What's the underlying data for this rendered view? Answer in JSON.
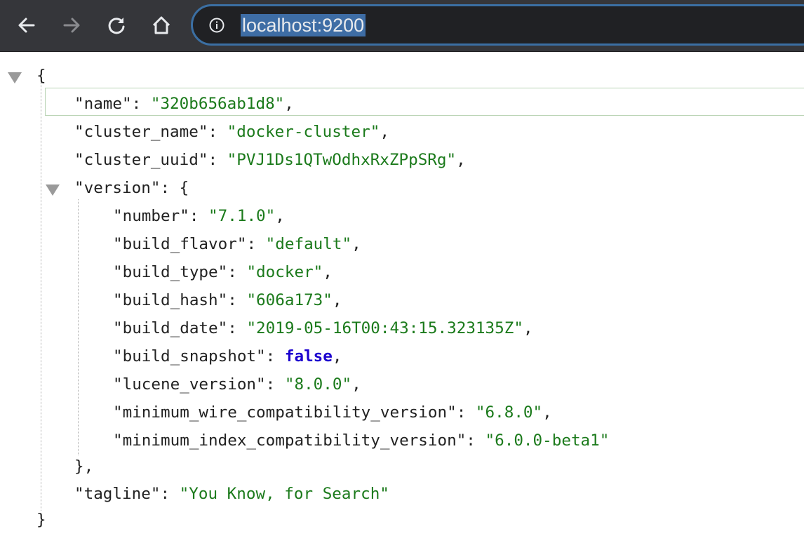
{
  "browser": {
    "back_icon": "arrow-left-icon",
    "forward_icon": "arrow-right-icon",
    "reload_icon": "reload-icon",
    "home_icon": "home-icon",
    "info_icon": "info-icon",
    "url": "localhost:9200",
    "colors": {
      "toolbar": "#35363a",
      "omnibox": "#202124",
      "focus_ring": "#3b6fa3",
      "selection": "#3e6da5"
    }
  },
  "json_viewer": {
    "open_brace": "{",
    "close_brace": "}",
    "fields": [
      {
        "key": "\"name\"",
        "value": "\"320b656ab1d8\"",
        "sep": ","
      },
      {
        "key": "\"cluster_name\"",
        "value": "\"docker-cluster\"",
        "sep": ","
      },
      {
        "key": "\"cluster_uuid\"",
        "value": "\"PVJ1Ds1QTwOdhxRxZPpSRg\"",
        "sep": ","
      }
    ],
    "version": {
      "key": "\"version\"",
      "open": "{",
      "close": "},",
      "fields": [
        {
          "key": "\"number\"",
          "value": "\"7.1.0\"",
          "sep": ","
        },
        {
          "key": "\"build_flavor\"",
          "value": "\"default\"",
          "sep": ","
        },
        {
          "key": "\"build_type\"",
          "value": "\"docker\"",
          "sep": ","
        },
        {
          "key": "\"build_hash\"",
          "value": "\"606a173\"",
          "sep": ","
        },
        {
          "key": "\"build_date\"",
          "value": "\"2019-05-16T00:43:15.323135Z\"",
          "sep": ","
        },
        {
          "key": "\"build_snapshot\"",
          "value": "false",
          "sep": ","
        },
        {
          "key": "\"lucene_version\"",
          "value": "\"8.0.0\"",
          "sep": ","
        },
        {
          "key": "\"minimum_wire_compatibility_version\"",
          "value": "\"6.8.0\"",
          "sep": ","
        },
        {
          "key": "\"minimum_index_compatibility_version\"",
          "value": "\"6.0.0-beta1\"",
          "sep": ""
        }
      ]
    },
    "tagline": {
      "key": "\"tagline\"",
      "value": "\"You Know, for Search\"",
      "sep": ""
    },
    "colors": {
      "key": "#222222",
      "string": "#1b7a1b",
      "boolean": "#1c00cf"
    }
  }
}
